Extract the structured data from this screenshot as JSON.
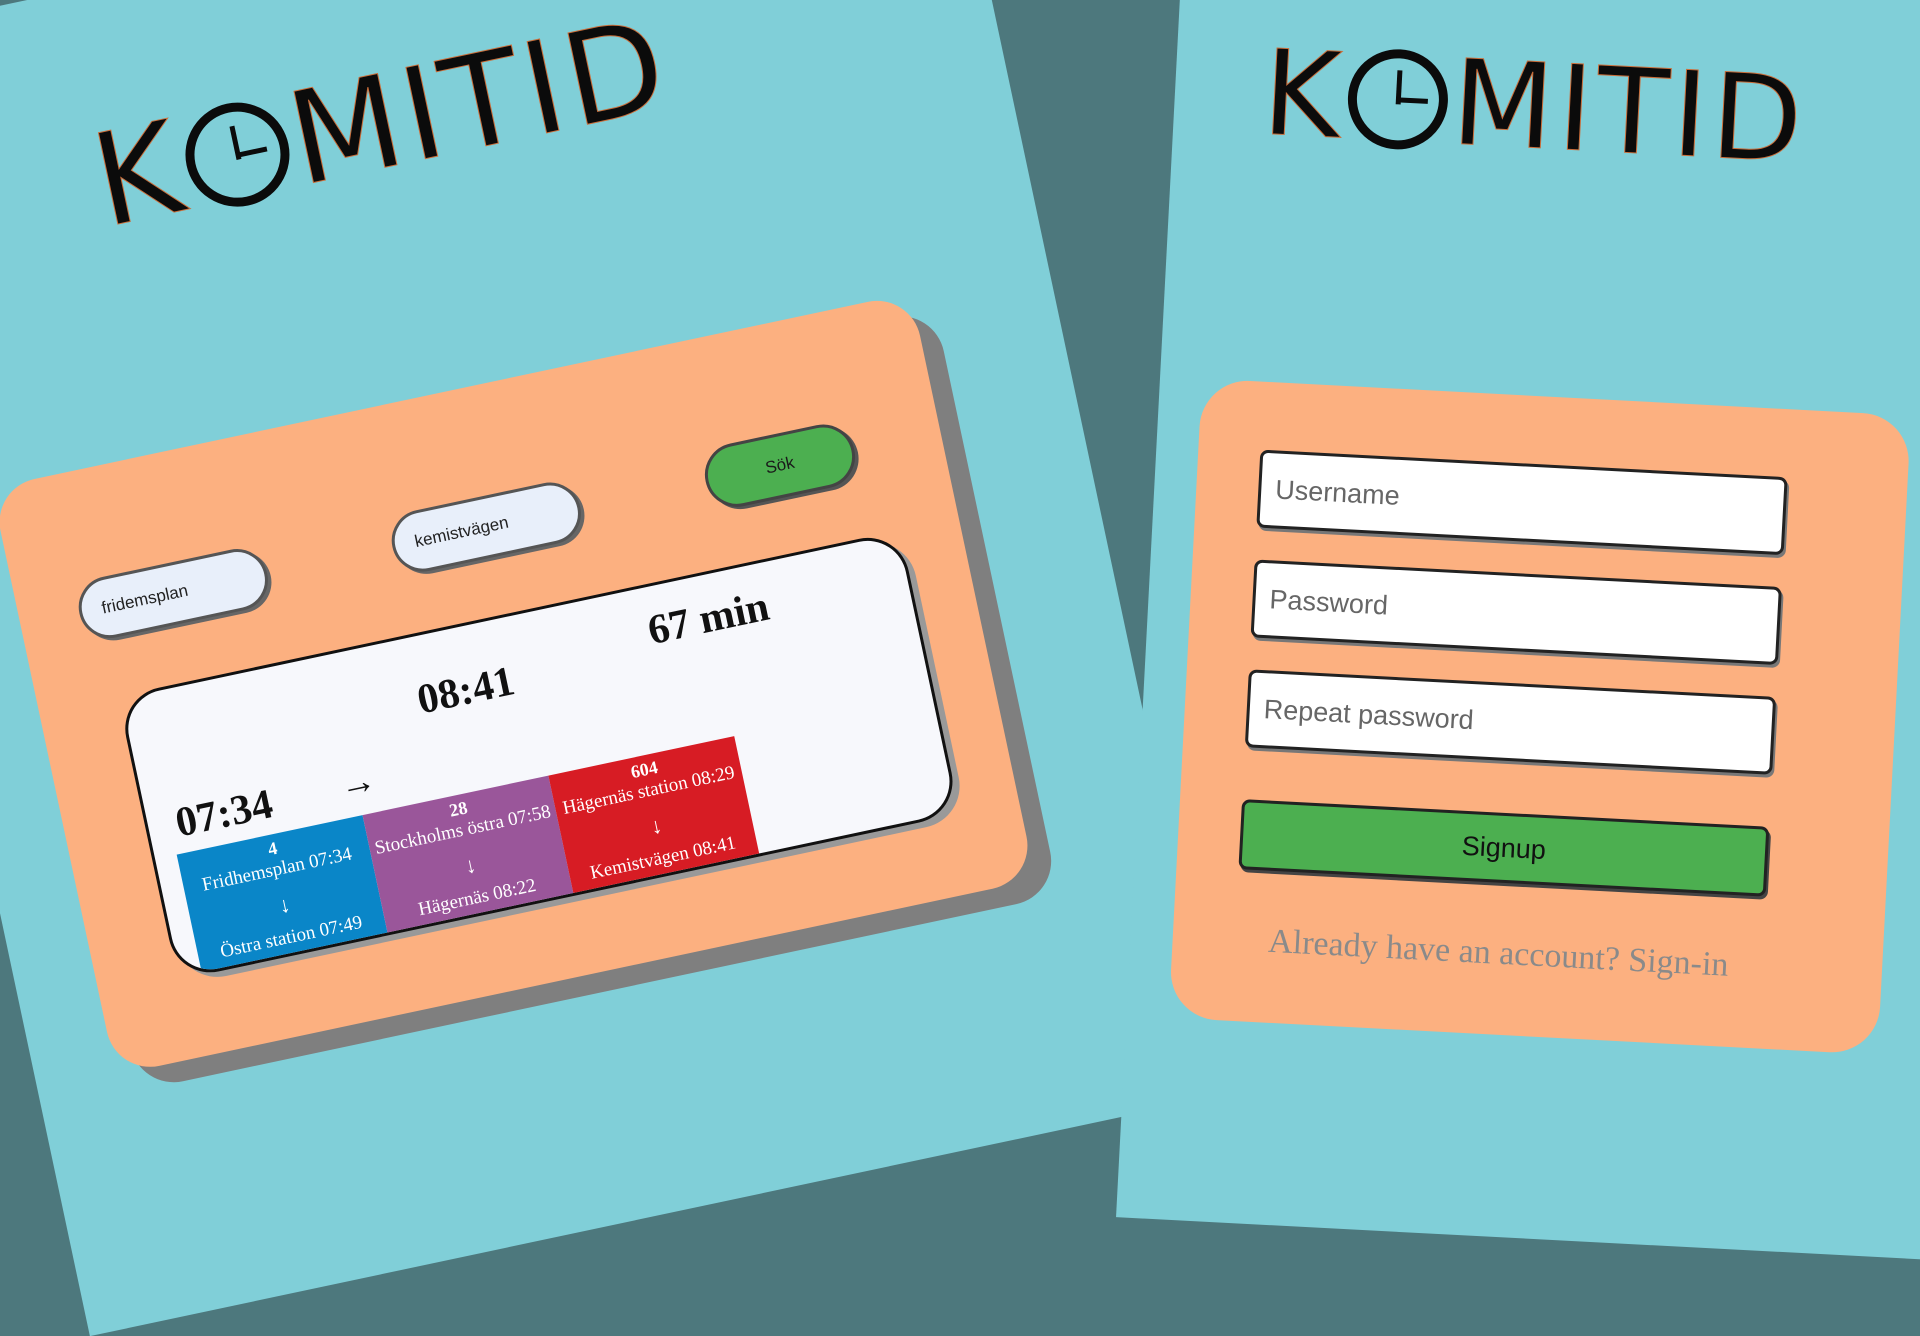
{
  "left_app": {
    "logo": {
      "before": "K",
      "after": "MITID"
    },
    "search": {
      "from_value": "fridemsplan",
      "to_value": "kemistvägen",
      "search_button": "Sök"
    },
    "result": {
      "depart": "07:34",
      "arrow": "→",
      "arrive": "08:41",
      "duration": "67 min",
      "legs": [
        {
          "line": "4",
          "from": "Fridhemsplan 07:34",
          "arrow": "↓",
          "to": "Östra station 07:49",
          "color": "#0a86c8"
        },
        {
          "line": "28",
          "from": "Stockholms östra 07:58",
          "arrow": "↓",
          "to": "Hägernäs 08:22",
          "color": "#9a569a"
        },
        {
          "line": "604",
          "from": "Hägernäs station 08:29",
          "arrow": "↓",
          "to": "Kemistvägen 08:41",
          "color": "#d71c24"
        }
      ]
    }
  },
  "right_app": {
    "logo": {
      "before": "K",
      "after": "MITID"
    },
    "signup": {
      "username_placeholder": "Username",
      "password_placeholder": "Password",
      "repeat_password_placeholder": "Repeat password",
      "signup_button": "Signup",
      "signin_link": "Already have an account? Sign-in"
    }
  },
  "colors": {
    "background": "#4d787d",
    "panel": "#80cfd8",
    "card": "#fcb080",
    "button_green": "#4caf50"
  },
  "icons": [
    "clock-icon"
  ]
}
